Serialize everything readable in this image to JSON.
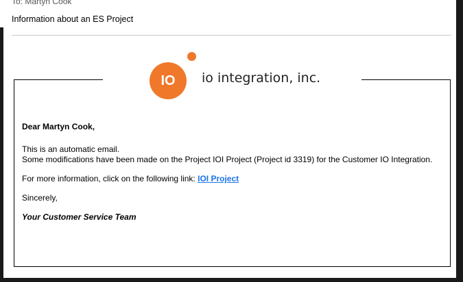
{
  "email": {
    "to_line": "To:  Martyn Cook",
    "subject": "Information about an ES Project"
  },
  "logo": {
    "mark_text": "IO",
    "company_name": "io integration, inc."
  },
  "message": {
    "greeting": "Dear Martyn Cook,",
    "line1": "This is an automatic email.",
    "line2": "Some modifications have been made on the Project IOI Project (Project id 3319) for the Customer IO Integration.",
    "info_prefix": "For more information, click on the following link: ",
    "link_text": "IOI Project",
    "closing": "Sincerely,",
    "signature": "Your Customer Service Team"
  },
  "colors": {
    "brand_orange": "#f0782a",
    "link_blue": "#1a73e8"
  }
}
